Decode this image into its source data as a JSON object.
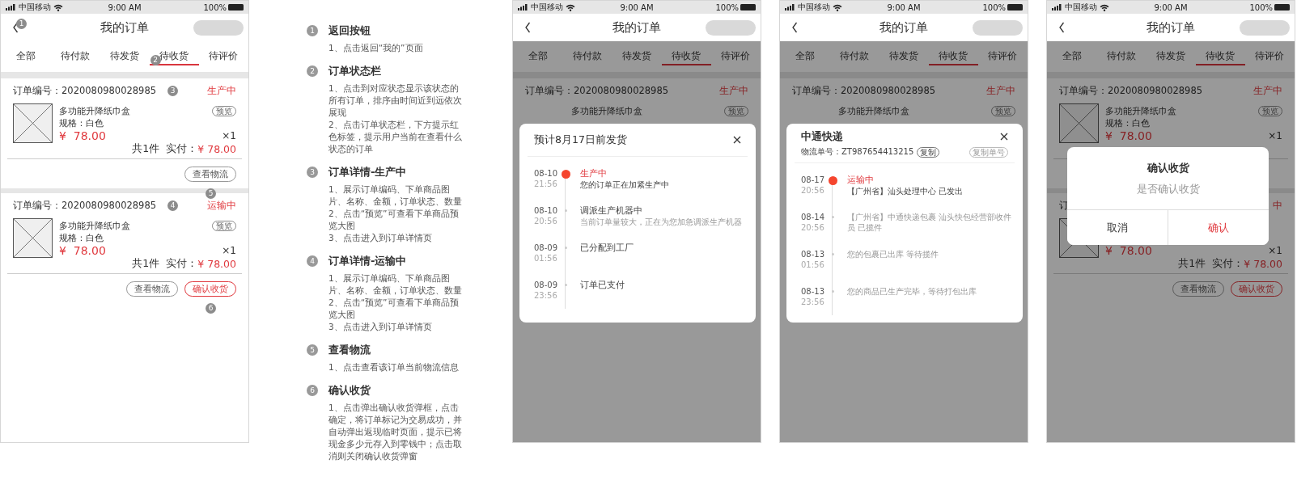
{
  "panels": [
    {
      "kind": "phone",
      "status_bar": {
        "carrier": "中国移动",
        "time": "9:00 AM",
        "battery": "100%"
      },
      "title": "我的订单",
      "back_marker": "1",
      "tabs": [
        {
          "label": "全部",
          "selected": false
        },
        {
          "label": "待付款",
          "selected": false
        },
        {
          "label": "待发货",
          "selected": false
        },
        {
          "label": "待收货",
          "selected": true,
          "marker": "2"
        },
        {
          "label": "待评价",
          "selected": false
        }
      ],
      "orders": [
        {
          "order_no": "订单编号：2020080980028985",
          "marker": "3",
          "status": "生产中",
          "product": "多功能升降纸巾盒",
          "preview": "预览",
          "spec": "规格：白色",
          "price": "¥  78.00",
          "qty": "×1",
          "count": "共1件",
          "paid_label": "实付：",
          "paid": "¥ 78.00",
          "actions": [
            {
              "label": "查看物流",
              "kind": "outline",
              "marker": "5"
            }
          ]
        },
        {
          "order_no": "订单编号：2020080980028985",
          "marker": "4",
          "status": "运输中",
          "product": "多功能升降纸巾盒",
          "preview": "预览",
          "spec": "规格：白色",
          "price": "¥  78.00",
          "qty": "×1",
          "count": "共1件",
          "paid_label": "实付：",
          "paid": "¥ 78.00",
          "actions": [
            {
              "label": "查看物流",
              "kind": "outline"
            },
            {
              "label": "确认收货",
              "kind": "primary",
              "marker": "6"
            }
          ]
        }
      ]
    },
    {
      "kind": "notes",
      "notes": [
        {
          "number": "1",
          "title": "返回按钮",
          "lines": [
            "1、点击返回“我的”页面"
          ]
        },
        {
          "number": "2",
          "title": "订单状态栏",
          "lines": [
            "1、点击到对应状态显示该状态的所有订单，排序由时间近到远依次展现",
            "2、点击订单状态栏，下方提示红色标签，提示用户当前在查看什么状态的订单"
          ]
        },
        {
          "number": "3",
          "title": "订单详情-生产中",
          "lines": [
            "1、展示订单编码、下单商品图片、名称、金额，订单状态、数量",
            "2、点击“预览”可查看下单商品预览大图",
            "3、点击进入到订单详情页"
          ]
        },
        {
          "number": "4",
          "title": "订单详情-运输中",
          "lines": [
            "1、展示订单编码、下单商品图片、名称、金额，订单状态、数量",
            "2、点击“预览”可查看下单商品预览大图",
            "3、点击进入到订单详情页"
          ]
        },
        {
          "number": "5",
          "title": "查看物流",
          "lines": [
            "1、点击查看该订单当前物流信息"
          ]
        },
        {
          "number": "6",
          "title": "确认收货",
          "lines": [
            "1、点击弹出确认收货弹框，点击确定，将订单标记为交易成功，并自动弹出返现临时页面，提示已将现金多少元存入到零钱中；点击取消则关闭确认收货弹窗"
          ]
        }
      ]
    },
    {
      "kind": "phone",
      "status_bar": {
        "carrier": "中国移动",
        "time": "9:00 AM",
        "battery": "100%"
      },
      "title": "我的订单",
      "tabs": [
        {
          "label": "全部",
          "selected": false
        },
        {
          "label": "待付款",
          "selected": false
        },
        {
          "label": "待发货",
          "selected": false
        },
        {
          "label": "待收货",
          "selected": true
        },
        {
          "label": "待评价",
          "selected": false
        }
      ],
      "orders": [
        {
          "order_no": "订单编号：2020080980028985",
          "status": "生产中",
          "product": "多功能升降纸巾盒",
          "preview": "预览",
          "image": false
        }
      ],
      "modal": {
        "kind": "timeline",
        "title": "预计8月17日前发货",
        "events": [
          {
            "date": "08-10",
            "time": "21:56",
            "title": "生产中",
            "detail": "您的订单正在加紧生产中",
            "current": true
          },
          {
            "date": "08-10",
            "time": "20:56",
            "title": "调派生产机器中",
            "detail": "当前订单量较大，正在为您加急调派生产机器",
            "current": false
          },
          {
            "date": "08-09",
            "time": "01:56",
            "title": "已分配到工厂",
            "current": false
          },
          {
            "date": "08-09",
            "time": "23:56",
            "title": "订单已支付",
            "current": false
          }
        ]
      }
    },
    {
      "kind": "phone",
      "status_bar": {
        "carrier": "中国移动",
        "time": "9:00 AM",
        "battery": "100%"
      },
      "title": "我的订单",
      "tabs": [
        {
          "label": "全部",
          "selected": false
        },
        {
          "label": "待付款",
          "selected": false
        },
        {
          "label": "待发货",
          "selected": false
        },
        {
          "label": "待收货",
          "selected": true
        },
        {
          "label": "待评价",
          "selected": false
        }
      ],
      "orders": [
        {
          "order_no": "订单编号：2020080980028985",
          "status": "生产中",
          "product": "多功能升降纸巾盒",
          "preview": "预览",
          "image": false
        }
      ],
      "modal": {
        "kind": "tracking",
        "title": "中通快递",
        "tracking": "物流单号：ZT987654413215",
        "copy": "复制",
        "copy_number": "复制单号",
        "events": [
          {
            "date": "08-17",
            "time": "20:56",
            "title": "运输中",
            "detail": "【广州省】汕头处理中心 已发出",
            "current": true
          },
          {
            "date": "08-14",
            "time": "20:56",
            "detail": "【广州省】中通快递包裹 汕头快包经营部收件员 已揽件",
            "current": false
          },
          {
            "date": "08-13",
            "time": "01:56",
            "detail": "您的包裹已出库 等待揽件",
            "current": false
          },
          {
            "date": "08-13",
            "time": "23:56",
            "detail": "您的商品已生产完毕，等待打包出库",
            "current": false
          }
        ]
      }
    },
    {
      "kind": "phone",
      "status_bar": {
        "carrier": "中国移动",
        "time": "9:00 AM",
        "battery": "100%"
      },
      "title": "我的订单",
      "tabs": [
        {
          "label": "全部",
          "selected": false
        },
        {
          "label": "待付款",
          "selected": false
        },
        {
          "label": "待发货",
          "selected": false
        },
        {
          "label": "待收货",
          "selected": true
        },
        {
          "label": "待评价",
          "selected": false
        }
      ],
      "orders": [
        {
          "order_no": "订单编号：2020080980028985",
          "status": "生产中",
          "product": "多功能升降纸巾盒",
          "preview": "预览",
          "spec": "规格：白色",
          "price": "¥  78.00",
          "qty": "×1"
        },
        {
          "order_no": "订",
          "status": "中",
          "price": "¥  78.00",
          "qty": "×1",
          "count": "共1件",
          "paid_label": "实付：",
          "paid": "¥ 78.00",
          "actions": [
            {
              "label": "查看物流",
              "kind": "outline"
            },
            {
              "label": "确认收货",
              "kind": "primary"
            }
          ]
        }
      ],
      "modal": {
        "kind": "confirm",
        "title": "确认收货",
        "message": "是否确认收货",
        "cancel": "取消",
        "confirm": "确认"
      }
    }
  ]
}
